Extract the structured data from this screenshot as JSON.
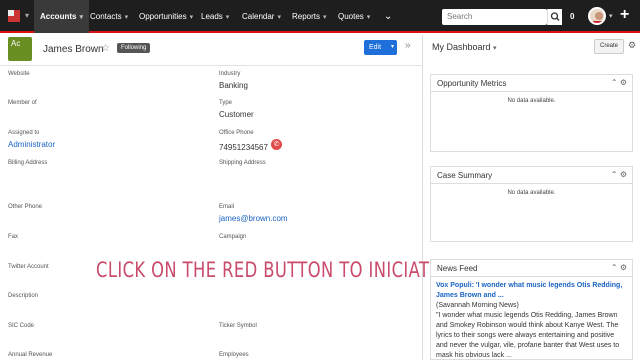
{
  "nav": {
    "items": [
      "Accounts",
      "Contacts",
      "Opportunities",
      "Leads",
      "Calendar",
      "Reports",
      "Quotes"
    ],
    "search_placeholder": "Search",
    "notifications": "0"
  },
  "record": {
    "icon_text": "Ac",
    "name": "James Brown",
    "following": "Following",
    "edit_label": "Edit"
  },
  "fields": {
    "website_label": "Website",
    "industry_label": "Industry",
    "industry_value": "Banking",
    "member_of_label": "Member of",
    "type_label": "Type",
    "type_value": "Customer",
    "assigned_label": "Assigned to",
    "assigned_value": "Administrator",
    "office_phone_label": "Office Phone",
    "office_phone_value": "74951234567",
    "billing_label": "Billing Address",
    "shipping_label": "Shipping Address",
    "other_phone_label": "Other Phone",
    "email_label": "Email",
    "email_value": "james@brown.com",
    "fax_label": "Fax",
    "campaign_label": "Campaign",
    "twitter_label": "Twitter Account",
    "description_label": "Description",
    "sic_label": "SIC Code",
    "ticker_label": "Ticker Symbol",
    "revenue_label": "Annual Revenue",
    "employees_label": "Employees"
  },
  "caption": "CLICK ON THE RED BUTTON TO INICIATE A CALL",
  "dashboard": {
    "title": "My Dashboard",
    "create_label": "Create",
    "dashlets": {
      "opportunity_title": "Opportunity Metrics",
      "opportunity_body": "No data available.",
      "case_title": "Case Summary",
      "case_body": "No data available.",
      "news_title": "News Feed",
      "news_headline": "Vox Populi: 'I wonder what music legends Otis Redding, James Brown and ...",
      "news_source": "(Savannah Morning News)",
      "news_text": "\"I wonder what music legends Otis Redding, James Brown and Smokey Robinson would think about Kanye West. The lyrics to their songs were always entertaining and positive and never the vulgar, vile, profane banter that West uses to mask his obvious lack ..."
    }
  },
  "colors": {
    "nav_bg": "#1e1e1e",
    "accent_red": "#dd1111",
    "link_blue": "#1b64c3",
    "edit_blue": "#1e6fd9",
    "record_icon": "#6b8e23",
    "caption": "#c94a6a"
  }
}
